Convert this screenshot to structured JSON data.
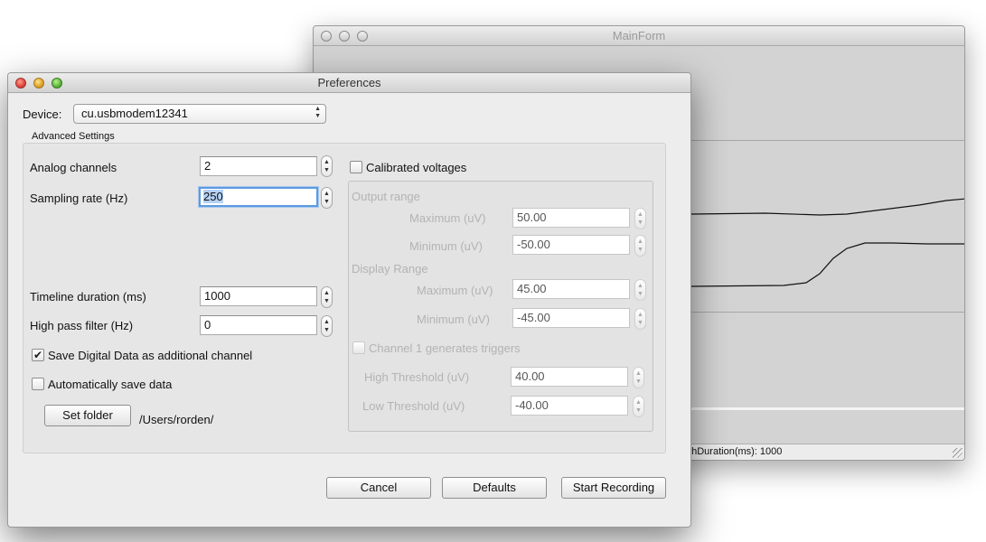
{
  "main_form": {
    "title": "MainForm",
    "status_text": "phDuration(ms): 1000"
  },
  "prefs": {
    "title": "Preferences",
    "device_label": "Device:",
    "device_value": "cu.usbmodem12341",
    "advanced_label": "Advanced Settings",
    "analog_label": "Analog channels",
    "analog_value": "2",
    "sampling_label": "Sampling rate (Hz)",
    "sampling_value": "250",
    "timeline_label": "Timeline duration (ms)",
    "timeline_value": "1000",
    "highpass_label": "High pass filter (Hz)",
    "highpass_value": "0",
    "save_digital_label": "Save Digital Data as additional channel",
    "save_digital_checked": true,
    "auto_save_label": "Automatically save data",
    "auto_save_checked": false,
    "set_folder_label": "Set folder",
    "folder_path": "/Users/rorden/",
    "calibrated_label": "Calibrated voltages",
    "calibrated_checked": false,
    "output_range_label": "Output range",
    "out_max_label": "Maximum (uV)",
    "out_max_value": "50.00",
    "out_min_label": "Minimum (uV)",
    "out_min_value": "-50.00",
    "display_range_label": "Display Range",
    "disp_max_label": "Maximum (uV)",
    "disp_max_value": "45.00",
    "disp_min_label": "Minimum (uV)",
    "disp_min_value": "-45.00",
    "trigger_label": "Channel 1 generates triggers",
    "trigger_checked": false,
    "high_thresh_label": "High Threshold (uV)",
    "high_thresh_value": "40.00",
    "low_thresh_label": "Low Threshold (uV)",
    "low_thresh_value": "-40.00",
    "cancel_label": "Cancel",
    "defaults_label": "Defaults",
    "start_label": "Start Recording"
  },
  "icons": {
    "stepper": "up-down-arrows",
    "checkmark": "check-icon",
    "select_arrows": "chevron-up-down-icon"
  }
}
